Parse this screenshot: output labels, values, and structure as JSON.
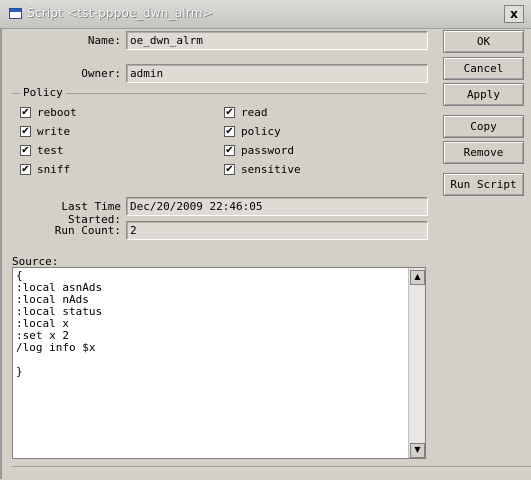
{
  "window": {
    "title": "Script <tst-pppoe_dwn_alrm>",
    "close_glyph": "x"
  },
  "form": {
    "name_label": "Name:",
    "name_value": "oe_dwn_alrm",
    "owner_label": "Owner:",
    "owner_value": "admin",
    "policy_label": "Policy",
    "policies": [
      {
        "label": "reboot",
        "checked": true
      },
      {
        "label": "write",
        "checked": true
      },
      {
        "label": "test",
        "checked": true
      },
      {
        "label": "sniff",
        "checked": true
      },
      {
        "label": "read",
        "checked": true
      },
      {
        "label": "policy",
        "checked": true
      },
      {
        "label": "password",
        "checked": true
      },
      {
        "label": "sensitive",
        "checked": true
      }
    ],
    "last_started_label": "Last Time Started:",
    "last_started_value": "Dec/20/2009 22:46:05",
    "run_count_label": "Run Count:",
    "run_count_value": "2",
    "source_label": "Source:",
    "source_text": "{\n:local asnAds\n:local nAds\n:local status\n:local x\n:set x 2\n/log info $x\n\n}"
  },
  "buttons": {
    "ok": "OK",
    "cancel": "Cancel",
    "apply": "Apply",
    "copy": "Copy",
    "remove": "Remove",
    "run_script": "Run Script"
  },
  "icons": {
    "check_glyph": "✔",
    "scroll_up": "▲",
    "scroll_down": "▼"
  }
}
